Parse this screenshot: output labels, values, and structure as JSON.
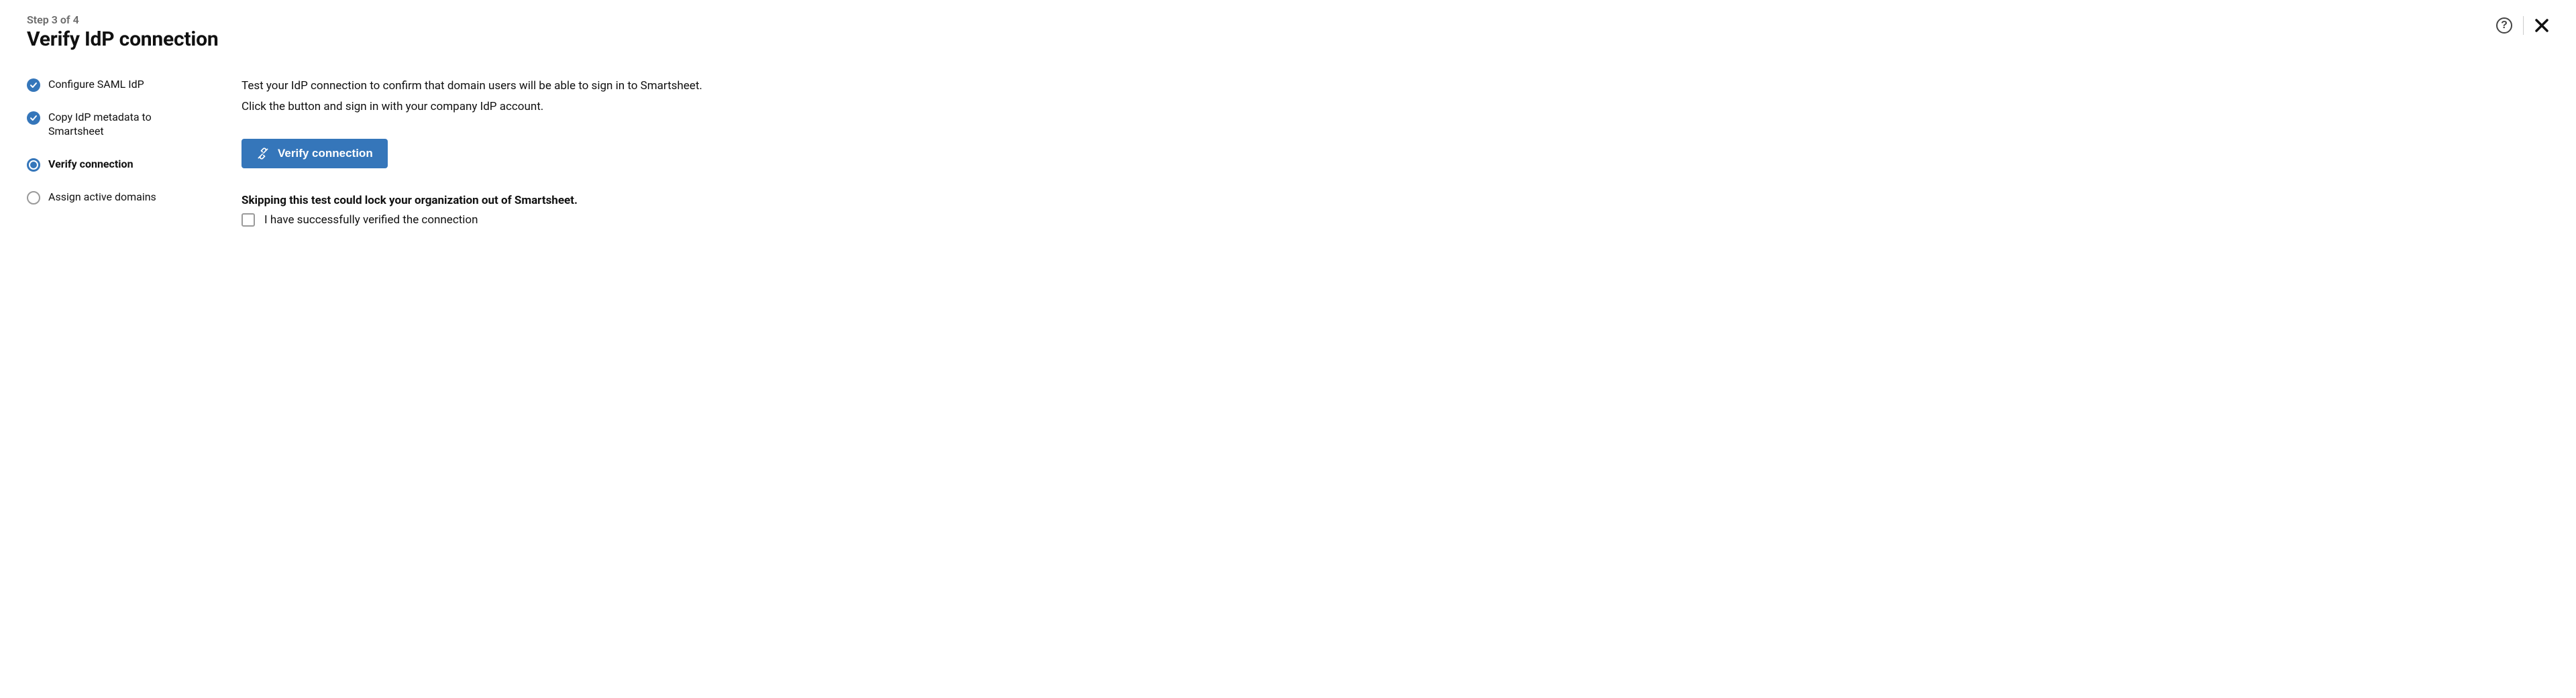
{
  "header": {
    "step_indicator": "Step 3 of 4",
    "title": "Verify IdP connection"
  },
  "stepper": {
    "items": [
      {
        "label": "Configure SAML IdP",
        "status": "done"
      },
      {
        "label": "Copy IdP metadata to Smartsheet",
        "status": "done"
      },
      {
        "label": "Verify connection",
        "status": "current"
      },
      {
        "label": "Assign active domains",
        "status": "upcoming"
      }
    ]
  },
  "content": {
    "intro_line1": "Test your IdP connection to confirm that domain users will be able to sign in to Smartsheet.",
    "intro_line2": "Click the button and sign in with your company IdP account.",
    "verify_button_label": "Verify connection",
    "warning": "Skipping this test could lock your organization out of Smartsheet.",
    "checkbox_label": "I have successfully verified the connection",
    "checkbox_checked": false
  }
}
